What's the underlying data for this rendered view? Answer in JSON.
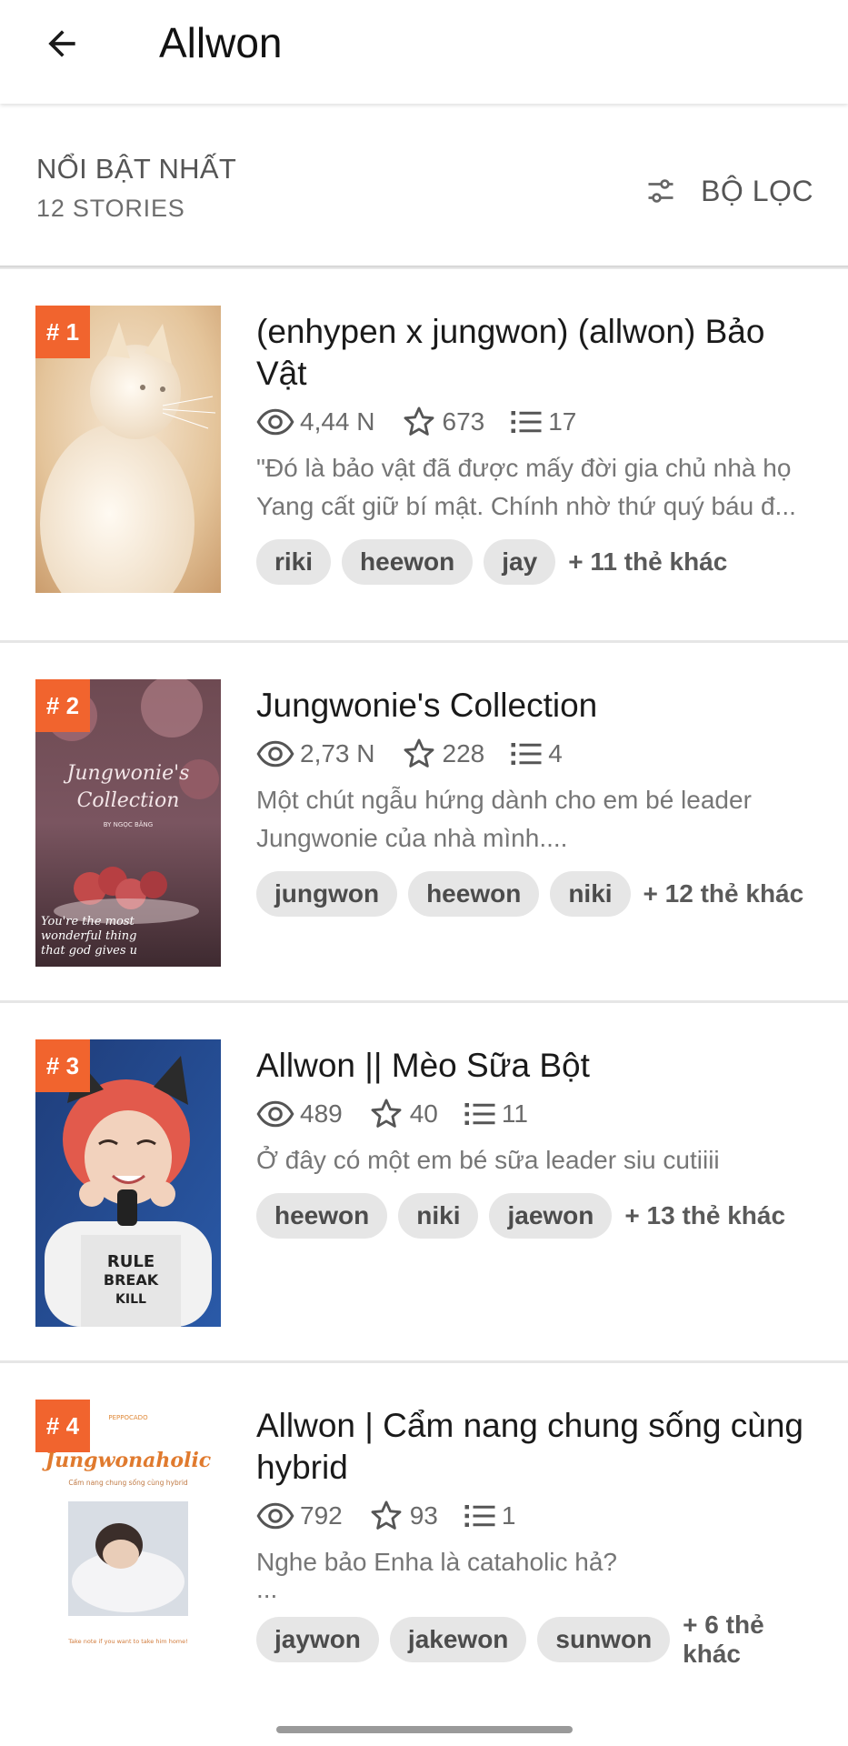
{
  "appbar": {
    "title": "Allwon"
  },
  "section": {
    "title": "NỔI BẬT NHẤT",
    "subtitle": "12 STORIES",
    "filter_label": "BỘ LỌC"
  },
  "stories": [
    {
      "rank": "# 1",
      "title": "(enhypen x jungwon) (allwon) Bảo Vật",
      "views": "4,44 N",
      "votes": "673",
      "parts": "17",
      "description": "\"Đó là bảo vật đã được mấy đời gia chủ nhà họ",
      "description2": "Yang cất giữ bí mật. Chính nhờ thứ quý báu đ...",
      "tags": [
        "riki",
        "heewon",
        "jay"
      ],
      "more_tags": "+ 11 thẻ khác"
    },
    {
      "rank": "# 2",
      "title": "Jungwonie's Collection",
      "views": "2,73 N",
      "votes": "228",
      "parts": "4",
      "description": "Một chút ngẫu hứng dành cho em bé leader",
      "description2": "Jungwonie của nhà mình....",
      "cover_text": "Jungwonie's Collection",
      "cover_byline": "BY NGỌC BĂNG",
      "cover_quote": "You're the most wonderful thing that god gives u",
      "tags": [
        "jungwon",
        "heewon",
        "niki"
      ],
      "more_tags": "+ 12 thẻ khác"
    },
    {
      "rank": "# 3",
      "title": "Allwon || Mèo Sữa Bột",
      "views": "489",
      "votes": "40",
      "parts": "11",
      "description": "Ở đây có một em bé sữa leader siu cutiiii",
      "tags": [
        "heewon",
        "niki",
        "jaewon"
      ],
      "more_tags": "+ 13 thẻ khác"
    },
    {
      "rank": "# 4",
      "title": "Allwon | Cẩm nang chung sống cùng hybrid",
      "views": "792",
      "votes": "93",
      "parts": "1",
      "description": "Nghe bảo Enha là cataholic hả?",
      "description2": "...",
      "cover_brand": "PEPPOCADO",
      "cover_text": "Jungwonaholic",
      "cover_sub": "Cẩm nang chung sống cùng hybrid",
      "cover_note": "Take note if you want to take him home!",
      "tags": [
        "jaywon",
        "jakewon",
        "sunwon"
      ],
      "more_tags": "+ 6 thẻ khác"
    }
  ],
  "colors": {
    "accent": "#f1642e",
    "tag_bg": "#e6e6e6",
    "divider": "#e6e6e6"
  },
  "icons": {
    "back": "arrow-left-icon",
    "filter": "sliders-icon",
    "views": "eye-icon",
    "votes": "star-icon",
    "parts": "list-icon"
  }
}
